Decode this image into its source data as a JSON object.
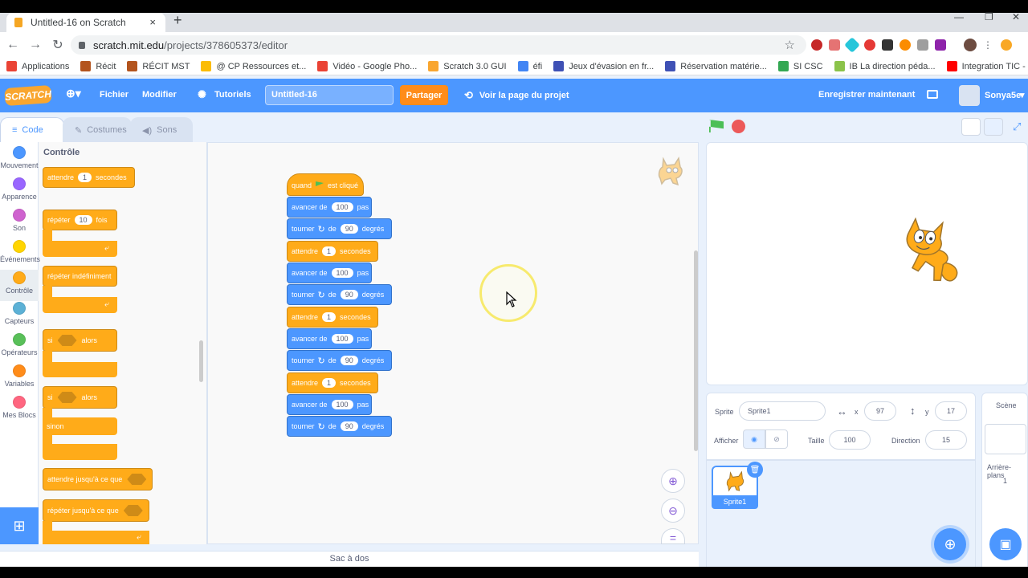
{
  "browser": {
    "tab_title": "Untitled-16 on Scratch",
    "new_tab": "+",
    "close_tab": "×",
    "url_host": "scratch.mit.edu",
    "url_path": "/projects/378605373/editor",
    "bookmarks": [
      {
        "label": "Applications",
        "color": "#ea4335"
      },
      {
        "label": "Récit",
        "color": "#b3541e"
      },
      {
        "label": "RÉCIT MST",
        "color": "#b3541e"
      },
      {
        "label": "@ CP Ressources et...",
        "color": "#fbbc05"
      },
      {
        "label": "Vidéo - Google Pho...",
        "color": "#ea4335"
      },
      {
        "label": "Scratch 3.0 GUI",
        "color": "#f9a630"
      },
      {
        "label": "éfi",
        "color": "#4285f4"
      },
      {
        "label": "Jeux d'évasion en fr...",
        "color": "#3f51b5"
      },
      {
        "label": "Réservation matérie...",
        "color": "#3f51b5"
      },
      {
        "label": "SI CSC",
        "color": "#34a853"
      },
      {
        "label": "IB La direction péda...",
        "color": "#8bc34a"
      },
      {
        "label": "Integration TIC - Yo...",
        "color": "#ff0000"
      }
    ]
  },
  "menu": {
    "logo": "SCRATCH",
    "file": "Fichier",
    "edit": "Modifier",
    "tutorials": "Tutoriels",
    "project_title": "Untitled-16",
    "share": "Partager",
    "view_project_page": "Voir la page du projet",
    "save_now": "Enregistrer maintenant",
    "username": "Sonya5e"
  },
  "tabs": {
    "code": "Code",
    "costumes": "Costumes",
    "sounds": "Sons"
  },
  "categories": [
    {
      "label": "Mouvement",
      "color": "#4c97ff"
    },
    {
      "label": "Apparence",
      "color": "#9966ff"
    },
    {
      "label": "Son",
      "color": "#cf63cf"
    },
    {
      "label": "Événements",
      "color": "#ffd500"
    },
    {
      "label": "Contrôle",
      "color": "#ffab19"
    },
    {
      "label": "Capteurs",
      "color": "#5cb1d6"
    },
    {
      "label": "Opérateurs",
      "color": "#59c059"
    },
    {
      "label": "Variables",
      "color": "#ff8c1a"
    },
    {
      "label": "Mes Blocs",
      "color": "#ff6680"
    }
  ],
  "palette": {
    "title": "Contrôle",
    "wait": "attendre",
    "wait_val": "1",
    "seconds": "secondes",
    "repeat": "répéter",
    "repeat_val": "10",
    "times": "fois",
    "forever": "répéter indéfiniment",
    "if": "si",
    "then": "alors",
    "else": "sinon",
    "wait_until": "attendre jusqu'à ce que",
    "repeat_until": "répéter jusqu'à ce que"
  },
  "script": {
    "when": "quand",
    "clicked": "est cliqué",
    "move": "avancer de",
    "move_val": "100",
    "steps": "pas",
    "turn": "tourner",
    "of": "de",
    "turn_val": "90",
    "degrees": "degrés",
    "wait": "attendre",
    "wait_val": "1",
    "seconds": "secondes"
  },
  "backpack": "Sac à dos",
  "sprite_info": {
    "sprite_label": "Sprite",
    "sprite_name": "Sprite1",
    "x_label": "x",
    "x": "97",
    "y_label": "y",
    "y": "17",
    "show_label": "Afficher",
    "size_label": "Taille",
    "size": "100",
    "direction_label": "Direction",
    "direction": "15"
  },
  "sprite_tile": "Sprite1",
  "scene": {
    "title": "Scène",
    "backdrops_label": "Arrière-plans",
    "backdrops_count": "1"
  }
}
